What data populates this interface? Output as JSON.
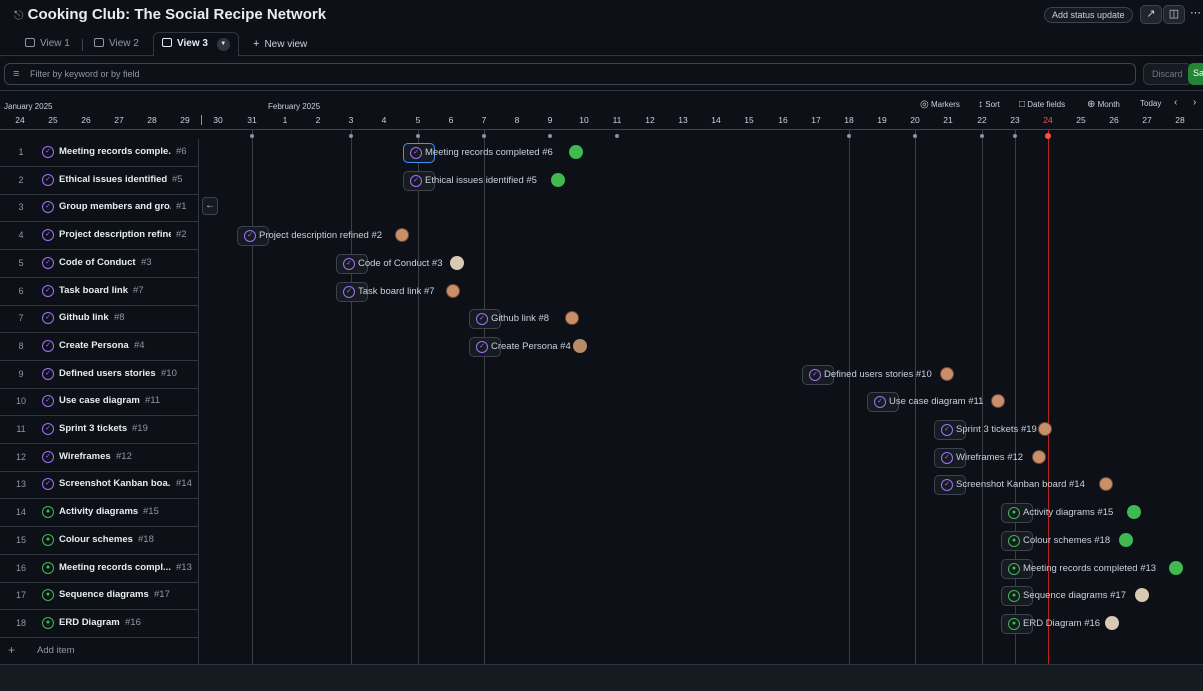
{
  "header": {
    "lock_icon": "lock-icon",
    "title": "Cooking Club: The Social Recipe Network",
    "add_status": "Add status update",
    "insights_icon": "chart-icon",
    "layout_icon": "panel-icon",
    "more_icon": "ellipsis-icon"
  },
  "tabs": {
    "view1": "View 1",
    "view2": "View 2",
    "view3": "View 3",
    "new_view": "New view"
  },
  "filter": {
    "placeholder": "Filter by keyword or by field",
    "discard": "Discard",
    "save": "Save"
  },
  "timeline": {
    "month1": "January 2025",
    "month2": "February 2025",
    "controls": {
      "markers": "Markers",
      "sort": "Sort",
      "date_fields": "Date fields",
      "month": "Month",
      "today": "Today"
    },
    "days": [
      "24",
      "25",
      "26",
      "27",
      "28",
      "29",
      "30",
      "31",
      "1",
      "2",
      "3",
      "4",
      "5",
      "6",
      "7",
      "8",
      "9",
      "10",
      "11",
      "12",
      "13",
      "14",
      "15",
      "16",
      "17",
      "18",
      "19",
      "20",
      "21",
      "22",
      "23",
      "24",
      "25",
      "26",
      "27",
      "28"
    ],
    "today_day": "24"
  },
  "items": [
    {
      "n": "1",
      "title": "Meeting records comple...",
      "id": "#6",
      "bar": "Meeting records completed #6",
      "state": "closed",
      "avatar": "a2"
    },
    {
      "n": "2",
      "title": "Ethical issues identified",
      "id": "#5",
      "bar": "Ethical issues identified #5",
      "state": "closed",
      "avatar": "a2"
    },
    {
      "n": "3",
      "title": "Group members and gro...",
      "id": "#1",
      "bar": "",
      "state": "closed",
      "avatar": ""
    },
    {
      "n": "4",
      "title": "Project description refined",
      "id": "#2",
      "bar": "Project description refined #2",
      "state": "closed",
      "avatar": "a1"
    },
    {
      "n": "5",
      "title": "Code of Conduct",
      "id": "#3",
      "bar": "Code of Conduct #3",
      "state": "closed",
      "avatar": "a3"
    },
    {
      "n": "6",
      "title": "Task board link",
      "id": "#7",
      "bar": "Task board link #7",
      "state": "closed",
      "avatar": "a1"
    },
    {
      "n": "7",
      "title": "Github link",
      "id": "#8",
      "bar": "Github link #8",
      "state": "closed",
      "avatar": "a1"
    },
    {
      "n": "8",
      "title": "Create Persona",
      "id": "#4",
      "bar": "Create Persona #4",
      "state": "closed",
      "avatar": "a4"
    },
    {
      "n": "9",
      "title": "Defined users stories",
      "id": "#10",
      "bar": "Defined users stories #10",
      "state": "closed",
      "avatar": "a1"
    },
    {
      "n": "10",
      "title": "Use case diagram",
      "id": "#11",
      "bar": "Use case diagram #11",
      "state": "closed",
      "avatar": "a1"
    },
    {
      "n": "11",
      "title": "Sprint 3 tickets",
      "id": "#19",
      "bar": "Sprint 3 tickets #19",
      "state": "closed",
      "avatar": "a1"
    },
    {
      "n": "12",
      "title": "Wireframes",
      "id": "#12",
      "bar": "Wireframes #12",
      "state": "closed",
      "avatar": "a1"
    },
    {
      "n": "13",
      "title": "Screenshot Kanban boa...",
      "id": "#14",
      "bar": "Screenshot Kanban board #14",
      "state": "closed",
      "avatar": "a1"
    },
    {
      "n": "14",
      "title": "Activity diagrams",
      "id": "#15",
      "bar": "Activity diagrams #15",
      "state": "open",
      "avatar": "a2"
    },
    {
      "n": "15",
      "title": "Colour schemes",
      "id": "#18",
      "bar": "Colour schemes #18",
      "state": "open",
      "avatar": "a2"
    },
    {
      "n": "16",
      "title": "Meeting records compl...",
      "id": "#13",
      "bar": "Meeting records completed #13",
      "state": "open",
      "avatar": "a2"
    },
    {
      "n": "17",
      "title": "Sequence diagrams",
      "id": "#17",
      "bar": "Sequence diagrams #17",
      "state": "open",
      "avatar": "a3"
    },
    {
      "n": "18",
      "title": "ERD Diagram",
      "id": "#16",
      "bar": "ERD Diagram #16",
      "state": "open",
      "avatar": "a3"
    }
  ],
  "add_item": "Add item"
}
